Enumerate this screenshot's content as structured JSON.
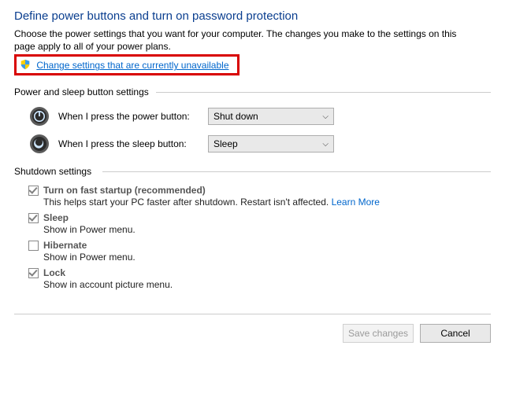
{
  "title": "Define power buttons and turn on password protection",
  "subtitle": "Choose the power settings that you want for your computer. The changes you make to the settings on this page apply to all of your power plans.",
  "change_link": "Change settings that are currently unavailable",
  "sections": {
    "power_header": "Power and sleep button settings",
    "shutdown_header": "Shutdown settings"
  },
  "power_rows": {
    "power_label": "When I press the power button:",
    "power_value": "Shut down",
    "sleep_label": "When I press the sleep button:",
    "sleep_value": "Sleep"
  },
  "shutdown": {
    "fast_startup": {
      "label": "Turn on fast startup (recommended)",
      "desc_a": "This helps start your PC faster after shutdown. Restart isn't affected. ",
      "learn": "Learn More",
      "checked": true
    },
    "sleep": {
      "label": "Sleep",
      "desc": "Show in Power menu.",
      "checked": true
    },
    "hibernate": {
      "label": "Hibernate",
      "desc": "Show in Power menu.",
      "checked": false
    },
    "lock": {
      "label": "Lock",
      "desc": "Show in account picture menu.",
      "checked": true
    }
  },
  "footer": {
    "save": "Save changes",
    "cancel": "Cancel"
  }
}
